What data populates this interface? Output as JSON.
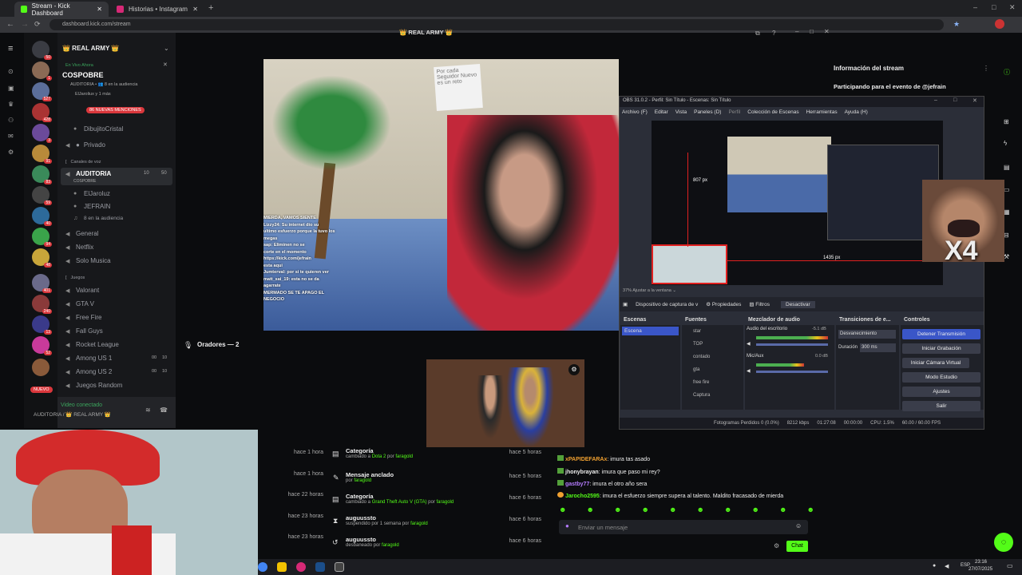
{
  "browser": {
    "tabs": [
      {
        "label": "Stream - Kick Dashboard"
      },
      {
        "label": "Historias • Instagram"
      }
    ],
    "url": "dashboard.kick.com/stream",
    "page_title": "👑 REAL ARMY 👑"
  },
  "discord": {
    "server_name": "👑 REAL ARMY 👑",
    "live_label": "En Vivo Ahora",
    "live_title": "COSPOBRE",
    "live_sub": "AUDITORIA • 👥 8 en la audiencia",
    "live_users": "ElJaroliux y 1 más",
    "mentions_badge": "86 NUEVAS MENCIONES",
    "channels": [
      {
        "name": "DibujitoCristal"
      },
      {
        "name": "Privado"
      }
    ],
    "voice_category": "Canales de voz",
    "auditoria": {
      "name": "AUDITORIA",
      "sub": "COSPOBRE",
      "count_a": "10",
      "count_b": "50"
    },
    "auditoria_users": [
      {
        "name": "ElJaroluz"
      },
      {
        "name": "JEFRAIN"
      }
    ],
    "audience_text": "8 en la audiencia",
    "voice_channels": [
      {
        "name": "General"
      },
      {
        "name": "Netflix"
      },
      {
        "name": "Solo Musica"
      }
    ],
    "games_category": "Juegos",
    "game_channels": [
      {
        "name": "Valorant"
      },
      {
        "name": "GTA V"
      },
      {
        "name": "Free Fire"
      },
      {
        "name": "Fall Guys"
      },
      {
        "name": "Rocket League"
      },
      {
        "name": "Among US 1",
        "c1": "00",
        "c2": "10"
      },
      {
        "name": "Among US 2",
        "c1": "00",
        "c2": "10"
      },
      {
        "name": "Juegos Random"
      }
    ],
    "video_connected": "Video conectado",
    "connected_where": "AUDITORIA / 👑 REAL ARMY 👑",
    "nuevo_badge": "NUEVO",
    "server_badges": [
      "50",
      "1",
      "527",
      "428",
      "3",
      "91",
      "83",
      "59",
      "40",
      "94",
      "48",
      "401",
      "240",
      "13",
      "52"
    ]
  },
  "kick": {
    "stream_info_title": "Información del stream",
    "stream_info_sub": "Participando para el evento de @jefrain",
    "speakers_label": "Oradores — 2",
    "video_overlay_lines": [
      "MIERDA, VAMOS SIENTE",
      "Lizzy24: Su internet dio su",
      "ultimo esfuerzo porque la tuvo los",
      "megas",
      "sap: Eliminen no se",
      "corte en el momento",
      "https://kick.com/jefrain",
      "esta aqui",
      "Jumterval: por si te quieren ver",
      "matt_sai_19: esta no se da",
      "agarrate",
      "MERMADO SE TE APAGO EL",
      "NEGOCIO"
    ],
    "sign_text": "Por cada Seguidor Nuevo es un reto",
    "activity": [
      {
        "time": "hace 1 hora",
        "title": "",
        "sub": ""
      },
      {
        "time": "hace 1 hora",
        "title": "",
        "sub": ""
      },
      {
        "time": "hace 22 horas",
        "title": "",
        "sub": ""
      },
      {
        "time": "hace 23 horas",
        "title": "",
        "sub": ""
      },
      {
        "time": "hace 23 horas",
        "title": "",
        "sub": ""
      }
    ],
    "activity2": [
      {
        "title": "Categoría",
        "sub_pre": "cambiado a ",
        "sub_hl": "Dota 2",
        "sub_mid": " por ",
        "sub_user": "faragold",
        "time": "hace 5 horas"
      },
      {
        "title": "Mensaje anclado",
        "sub_pre": "por ",
        "sub_hl": "",
        "sub_mid": "",
        "sub_user": "faragold",
        "time": "hace 5 horas"
      },
      {
        "title": "Categoría",
        "sub_pre": "cambiado a ",
        "sub_hl": "Grand Theft Auto V (GTA)",
        "sub_mid": " por ",
        "sub_user": "faragold",
        "time": "hace 6 horas"
      },
      {
        "title": "auguussto",
        "sub_pre": "suspendido por 1 semana por ",
        "sub_hl": "",
        "sub_mid": "",
        "sub_user": "faragold",
        "time": "hace 6 horas"
      },
      {
        "title": "auguussto",
        "sub_pre": "desbaneado por ",
        "sub_hl": "",
        "sub_mid": "",
        "sub_user": "faragold",
        "time": "hace 6 horas"
      }
    ],
    "chat": [
      {
        "user": "xPAPIDEFARAx",
        "msg": "imura tas asado",
        "color": "#f0a030"
      },
      {
        "user": "jhonybrayan",
        "msg": "imura que paso mi rey?",
        "color": "#dddddd"
      },
      {
        "user": "gastby77",
        "msg": "imura el otro año sera",
        "color": "#b57cff"
      },
      {
        "user": "Jarocho2595",
        "msg": "imura el esfuerzo siempre supera al talento. Maldito fracasado de mierda",
        "color": "#53fc18"
      }
    ],
    "chat_placeholder": "Enviar un mensaje",
    "chat_button": "Chat",
    "x4_label": "X4"
  },
  "obs": {
    "title": "OBS 31.0.2 - Perfil: Sin Título - Escenas: Sin Título",
    "menu": [
      "Archivo (F)",
      "Editar",
      "Vista",
      "Paneles (D)",
      "Perfil",
      "Colección de Escenas",
      "Herramientas",
      "Ayuda (H)"
    ],
    "zoom": "37%",
    "fit": "Ajustar a la ventana",
    "px_label": "807 px",
    "px_label2": "1435 px",
    "source_bar": {
      "device": "Dispositivo de captura de v",
      "props": "Propiedades",
      "filters": "Filtros",
      "deactivate": "Desactivar"
    },
    "scenes_header": "Escenas",
    "scene_item": "Escena",
    "sources_header": "Fuentes",
    "sources": [
      "star",
      "TOP",
      "contado",
      "gta",
      "free fire",
      "Captura"
    ],
    "mixer_header": "Mezclador de audio",
    "mixer": [
      {
        "name": "Audio del escritorio",
        "db": "-5.1 dB"
      },
      {
        "name": "Mic/Aux",
        "db": "0.0 dB"
      }
    ],
    "transitions_header": "Transiciones de e...",
    "transition": "Desvanecimiento",
    "duration_label": "Duración",
    "duration": "300 ms",
    "controls_header": "Controles",
    "controls": [
      "Detener Transmisión",
      "Iniciar Grabación",
      "Iniciar Cámara Virtual",
      "Modo Estudio",
      "Ajustes",
      "Salir"
    ],
    "status": {
      "frames": "Fotogramas Perdidos 0 (0.0%)",
      "kbps": "8212 kbps",
      "time1": "01:27:08",
      "time2": "00:00:00",
      "cpu": "CPU: 1.5%",
      "fps": "60.00 / 60.00 FPS"
    }
  },
  "taskbar": {
    "lang": "ESP",
    "time": "23:16",
    "date": "27/07/2025"
  }
}
